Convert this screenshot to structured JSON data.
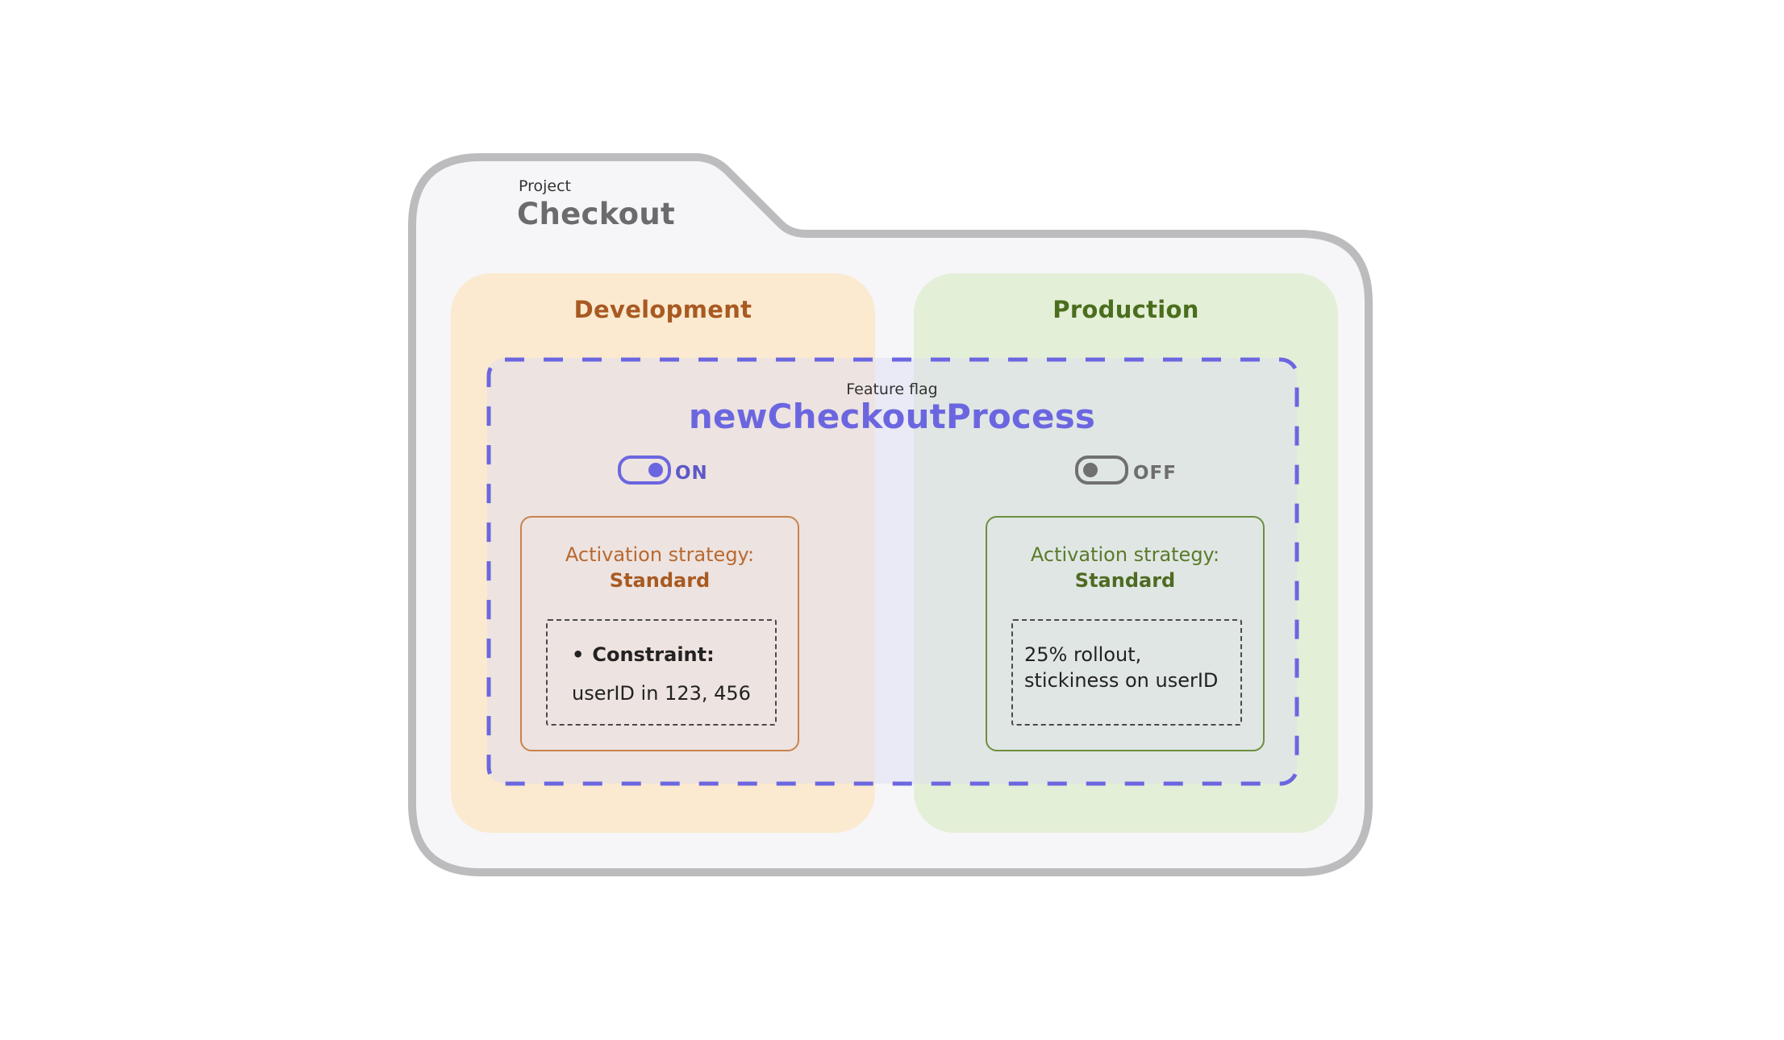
{
  "project": {
    "label": "Project",
    "name": "Checkout"
  },
  "environments": [
    {
      "name": "Development",
      "color": "#a85a22",
      "toggle": {
        "state": "on",
        "label": "ON"
      },
      "strategy": {
        "label": "Activation strategy:",
        "value": "Standard",
        "constraint_bullet": "•",
        "constraint_label": "Constraint:",
        "constraint_value": "userID in 123, 456"
      }
    },
    {
      "name": "Production",
      "color": "#4b6e1e",
      "toggle": {
        "state": "off",
        "label": "OFF"
      },
      "strategy": {
        "label": "Activation strategy:",
        "value": "Standard",
        "rollout_line1": "25% rollout,",
        "rollout_line2": "stickiness on userID"
      }
    }
  ],
  "feature_flag": {
    "label": "Feature flag",
    "name": "newCheckoutProcess",
    "color": "#6b66e0"
  },
  "colors": {
    "folder_stroke": "#bcbcbe",
    "folder_fill": "#f6f6f8",
    "dev_panel": "#fbead0",
    "prod_panel": "#e4efd7",
    "toggle_off": "#707070"
  }
}
